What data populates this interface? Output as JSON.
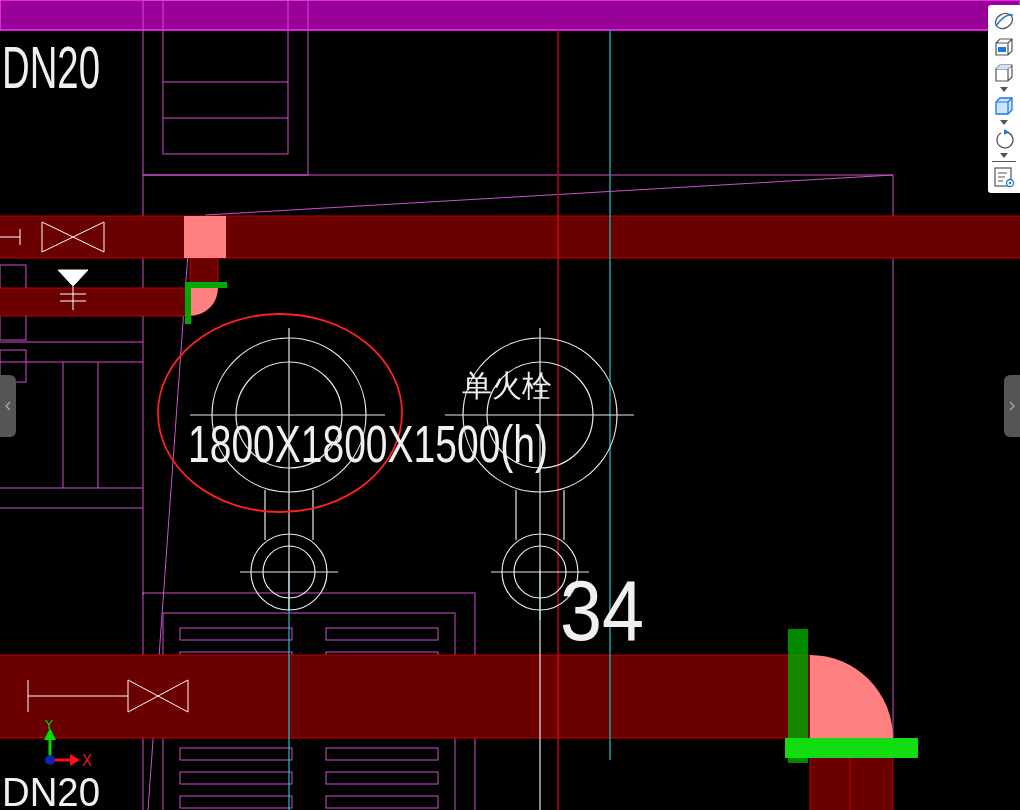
{
  "labels": [
    {
      "text": "DN20"
    },
    {
      "text": "单火栓"
    },
    {
      "text": "1800X1800X1500(h)"
    },
    {
      "text": "34"
    },
    {
      "text": "DN20"
    }
  ],
  "axes": {
    "x": "X",
    "y": "Y"
  }
}
